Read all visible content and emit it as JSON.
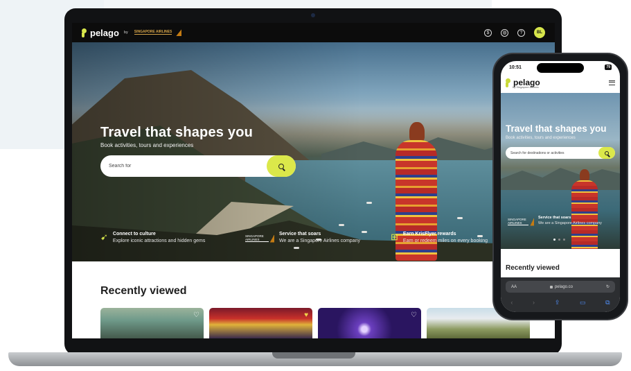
{
  "site": {
    "brand": "pelago",
    "by": "by",
    "partner": "SINGAPORE AIRLINES",
    "avatar_initials": "BL",
    "accent_color": "#dbe84a"
  },
  "header_icons": [
    "currency-icon",
    "globe-icon",
    "help-icon"
  ],
  "hero": {
    "title": "Travel that shapes you",
    "subtitle": "Book activities, tours and experiences",
    "search_placeholder": "Search for"
  },
  "features": [
    {
      "title": "Connect to culture",
      "desc": "Explore iconic attractions and hidden gems"
    },
    {
      "title": "Service that soars",
      "desc": "We are a Singapore Airlines company"
    },
    {
      "title": "Earn KrisFlyer rewards",
      "desc": "Earn or redeem miles on every booking"
    }
  ],
  "recently_viewed": {
    "title": "Recently viewed"
  },
  "phone": {
    "time": "10:51",
    "battery": "79",
    "brand": "pelago",
    "brand_sub": "by Singapore Airlines",
    "hero_title": "Travel that shapes you",
    "hero_subtitle": "Book activities, tours and experiences",
    "search_placeholder": "Search for destinations or activities",
    "feature_title": "Service that soars",
    "feature_desc": "We are a Singapore Airlines company",
    "recently_viewed": "Recently viewed",
    "url_aa": "AA",
    "url": "pelago.co"
  }
}
